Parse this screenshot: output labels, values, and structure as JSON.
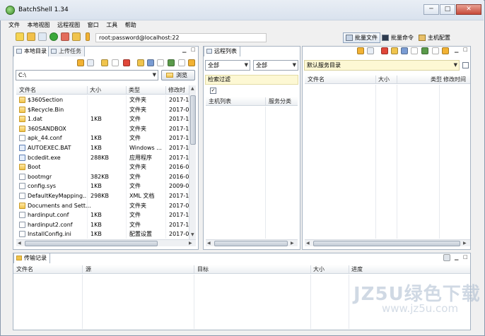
{
  "window": {
    "title": "BatchShell 1.34",
    "min_label": "─",
    "max_label": "□",
    "close_label": "✕"
  },
  "menu": [
    "文件",
    "本地视图",
    "远程视图",
    "窗口",
    "工具",
    "帮助"
  ],
  "toolbar": {
    "connection": "root:password@localhost:22"
  },
  "mode_buttons": [
    {
      "label": "批量文件",
      "active": true
    },
    {
      "label": "批量命令",
      "active": false
    },
    {
      "label": "主机配置",
      "active": false
    }
  ],
  "local_panel": {
    "tabs": [
      "本地目录",
      "上传任务"
    ],
    "path": "C:\\",
    "browse_label": "浏览",
    "columns": [
      "文件名",
      "大小",
      "类型",
      "修改时"
    ],
    "rows": [
      {
        "name": "$360Section",
        "size": "",
        "type": "文件夹",
        "date": "2017-1",
        "kind": "folder"
      },
      {
        "name": "$Recycle.Bin",
        "size": "",
        "type": "文件夹",
        "date": "2017-0",
        "kind": "folder"
      },
      {
        "name": "1.dat",
        "size": "1KB",
        "type": "文件",
        "date": "2017-1",
        "kind": "folder"
      },
      {
        "name": "360SANDBOX",
        "size": "",
        "type": "文件夹",
        "date": "2017-1",
        "kind": "folder"
      },
      {
        "name": "apk_44.conf",
        "size": "1KB",
        "type": "文件",
        "date": "2017-1",
        "kind": "file"
      },
      {
        "name": "AUTOEXEC.BAT",
        "size": "1KB",
        "type": "Windows ...",
        "date": "2017-1",
        "kind": "exe"
      },
      {
        "name": "bcdedit.exe",
        "size": "288KB",
        "type": "应用程序",
        "date": "2017-1",
        "kind": "exe"
      },
      {
        "name": "Boot",
        "size": "",
        "type": "文件夹",
        "date": "2016-0",
        "kind": "folder"
      },
      {
        "name": "bootmgr",
        "size": "382KB",
        "type": "文件",
        "date": "2016-0",
        "kind": "file"
      },
      {
        "name": "config.sys",
        "size": "1KB",
        "type": "文件",
        "date": "2009-0",
        "kind": "file"
      },
      {
        "name": "DefaultKeyMapping...",
        "size": "298KB",
        "type": "XML 文档",
        "date": "2017-1",
        "kind": "file"
      },
      {
        "name": "Documents and Sett...",
        "size": "",
        "type": "文件夹",
        "date": "2017-0",
        "kind": "folder"
      },
      {
        "name": "hardinput.conf",
        "size": "1KB",
        "type": "文件",
        "date": "2017-1",
        "kind": "file"
      },
      {
        "name": "hardinput2.conf",
        "size": "1KB",
        "type": "文件",
        "date": "2017-1",
        "kind": "file"
      },
      {
        "name": "InstallConfig.ini",
        "size": "1KB",
        "type": "配置设置",
        "date": "2017-0",
        "kind": "file"
      }
    ]
  },
  "remote_list_panel": {
    "tab": "远程列表",
    "filter1": "全部",
    "filter2": "全部",
    "search_label": "检索过滤",
    "check": "✓",
    "columns": [
      "主机列表",
      "服务分类"
    ]
  },
  "remote_dir_panel": {
    "directory": "默认服务目录",
    "columns": [
      "文件名",
      "大小",
      "类型",
      "修改时间"
    ]
  },
  "transfer_panel": {
    "tab": "传输记录",
    "columns": [
      "文件名",
      "源",
      "目标",
      "大小",
      "进度"
    ]
  },
  "watermark": {
    "line1": "JZ5U绿色下载",
    "line2": "www.jz5u.com"
  }
}
